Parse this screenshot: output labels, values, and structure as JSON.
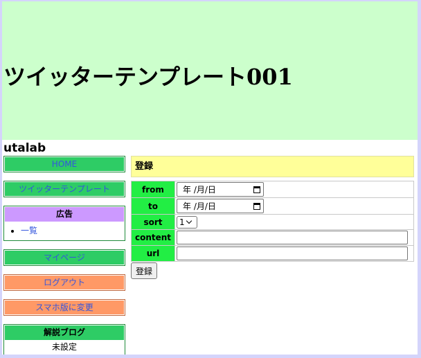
{
  "header": {
    "site_title": "ツイッターテンプレート001",
    "username": "utalab"
  },
  "sidebar": {
    "home_label": "HOME",
    "template_label": "ツイッターテンプレート",
    "ad_box": {
      "title": "広告",
      "items": [
        "一覧"
      ]
    },
    "mypage_label": "マイページ",
    "logout_label": "ログアウト",
    "mobile_label": "スマホ版に変更",
    "blog_box": {
      "title": "解説ブログ",
      "value": "未設定"
    }
  },
  "main": {
    "section_title": "登録",
    "form": {
      "from_label": "from",
      "from_value": "年 /月/日",
      "to_label": "to",
      "to_value": "年 /月/日",
      "sort_label": "sort",
      "sort_value": "1",
      "content_label": "content",
      "content_value": "",
      "url_label": "url",
      "url_value": "",
      "submit_label": "登録"
    }
  },
  "colors": {
    "header_bg": "#ccffcc",
    "sidebar_green": "#2ecc65",
    "sidebar_orange": "#ff9966",
    "ad_title_purple": "#cc99ff",
    "form_label_green": "#22ee44",
    "section_title_yellow": "#ffff99",
    "link_blue": "#3355dd"
  }
}
